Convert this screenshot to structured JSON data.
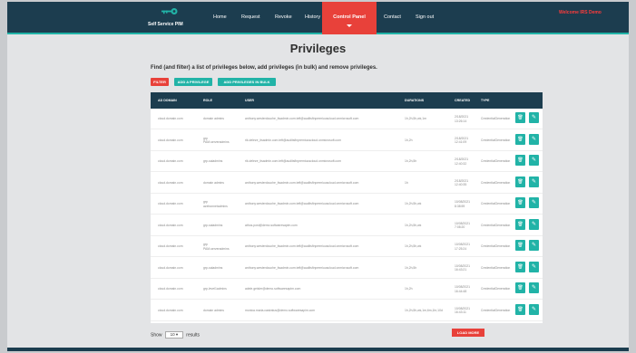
{
  "nav": {
    "logo_text": "Self Service PIM",
    "items": [
      "Home",
      "Request",
      "Revoke",
      "History"
    ],
    "active": "Control Panel",
    "after": [
      "Contact",
      "Sign out"
    ],
    "welcome": "Welcome IRS Demo"
  },
  "page": {
    "title": "Privileges",
    "subtitle": "Find (and filter) a list of privileges below, add privileges (in bulk) and remove privileges.",
    "filter_label": "FILTER",
    "add_label": "ADD A PRIVILEGE",
    "bulk_label": "ADD PRIVILEGES IN BULK"
  },
  "table": {
    "headers": [
      "AD DOMAIN",
      "ROLE",
      "USER",
      "DURATIONS",
      "CREATED",
      "TYPE"
    ],
    "rows": [
      {
        "domain": "cloud.domain.com",
        "role": "domain admins",
        "user": "anthony.westerdouche_itsadmin.com.teft@auditsfinpremiuuscloud.onmicrosoft.com",
        "durations": "1h,2h,5h,wk,1m",
        "created": "2/18/2021\n13:26:14",
        "type": "CredentialGeneration"
      },
      {
        "domain": "cloud.domain.com",
        "role": "grp\nPAM-serveradmins",
        "user": "rik.deleze_itsadmin.com.teft@auditsfinpremiuuscloud.onmicrosoft.com",
        "durations": "1h,2h",
        "created": "2/18/2021\n12:41:09",
        "type": "CredentialGeneration"
      },
      {
        "domain": "cloud.domain.com",
        "role": "grp-saladmins",
        "user": "rik.deleze_itsadmin.com.teft@auditsfinpremiuuscloud.onmicrosoft.com",
        "durations": "1h,2h,5h",
        "created": "2/18/2021\n12:40:32",
        "type": "CredentialGeneration"
      },
      {
        "domain": "cloud.domain.com",
        "role": "domain admins",
        "user": "anthony.westerdouche_itsadmin.com.teft@auditsfinpremiuuscloud.onmicrosoft.com",
        "durations": "1h",
        "created": "2/18/2021\n12:40:35",
        "type": "CredentialGeneration"
      },
      {
        "domain": "cloud.domain.com",
        "role": "grp\nazebonnetadmins",
        "user": "anthony.westerdouche_itsadmin.com.teft@auditsfinpremiuuscloud.onmicrosoft.com",
        "durations": "1h,2h,5h,wk",
        "created": "10/08/2021\n8:38:59",
        "type": "CredentialGeneration"
      },
      {
        "domain": "cloud.domain.com",
        "role": "grp-saladmins",
        "user": "athos.post@demo.softwaresapim.com",
        "durations": "1h,2h,5h,wk",
        "created": "10/08/2021\n7:08:20",
        "type": "CredentialGeneration"
      },
      {
        "domain": "cloud.domain.com",
        "role": "grp\nPAM-serveradmins",
        "user": "anthony.westerdouche_itsadmin.com.teft@auditsfinpremiuuscloud.onmicrosoft.com",
        "durations": "1h,2h,5h,wk",
        "created": "10/08/2021\n17:25:24",
        "type": "CredentialGeneration"
      },
      {
        "domain": "cloud.domain.com",
        "role": "grp-saladmins",
        "user": "anthony.westerdouche_itsadmin.com.teft@auditsfinpremiuuscloud.onmicrosoft.com",
        "durations": "1h,2h,5h",
        "created": "10/08/2021\n16:43:21",
        "type": "CredentialGeneration"
      },
      {
        "domain": "cloud.domain.com",
        "role": "grp-level1admins",
        "user": "adele.geisler@demo.softwaresapim.com",
        "durations": "1h,2h",
        "created": "10/08/2021\n16:44:48",
        "type": "CredentialGeneration"
      },
      {
        "domain": "cloud.domain.com",
        "role": "domain admins",
        "user": "monica.maria.castratus@demo.softwaresapim.com",
        "durations": "1h,2h,5h,wk,1m,6m,1hr,10d",
        "created": "10/08/2021\n16:43:11",
        "type": "CredentialGeneration"
      }
    ]
  },
  "footer": {
    "show_label": "Show",
    "show_value": "10",
    "results_label": "results",
    "loadmore_label": "LOAD MORE"
  }
}
